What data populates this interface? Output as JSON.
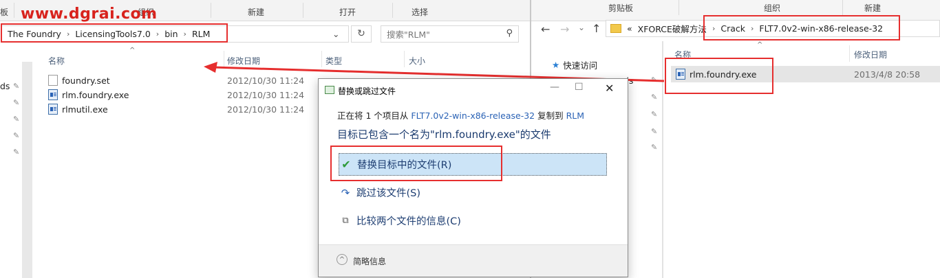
{
  "watermark": "www.dgrai.com",
  "left_window": {
    "ribbon": {
      "group_partial": "板",
      "group_organize": "组织",
      "group_new": "新建",
      "group_open": "打开",
      "group_select": "选择"
    },
    "breadcrumb": [
      "The Foundry",
      "LicensingTools7.0",
      "bin",
      "RLM"
    ],
    "search_placeholder": "搜索\"RLM\"",
    "columns": {
      "name": "名称",
      "date": "修改日期",
      "type": "类型",
      "size": "大小"
    },
    "files": [
      {
        "name": "foundry.set",
        "date": "2012/10/30 11:24",
        "icon": "document-icon"
      },
      {
        "name": "rlm.foundry.exe",
        "date": "2012/10/30 11:24",
        "icon": "exe-icon"
      },
      {
        "name": "rlmutil.exe",
        "date": "2012/10/30 11:24",
        "icon": "exe-icon"
      }
    ],
    "nav_partial": "ds"
  },
  "right_window": {
    "ribbon": {
      "group_clipboard": "剪贴板",
      "group_organize": "组织",
      "group_new": "新建"
    },
    "breadcrumb_prefix": "«",
    "breadcrumb": [
      "XFORCE破解方法",
      "Crack",
      "FLT7.0v2-win-x86-release-32"
    ],
    "quick_access": "快速访问",
    "nav_partial": "ds",
    "columns": {
      "name": "名称",
      "date": "修改日期"
    },
    "files": [
      {
        "name": "rlm.foundry.exe",
        "date": "2013/4/8 20:58",
        "icon": "exe-icon"
      }
    ]
  },
  "dialog": {
    "title": "替换或跳过文件",
    "copy_line": {
      "prefix": "正在将 1 个项目从 ",
      "source": "FLT7.0v2-win-x86-release-32",
      "mid": " 复制到 ",
      "dest": "RLM"
    },
    "heading": "目标已包含一个名为\"rlm.foundry.exe\"的文件",
    "option_replace": "替换目标中的文件(R)",
    "option_skip": "跳过该文件(S)",
    "option_compare": "比较两个文件的信息(C)",
    "footer_label": "简略信息"
  },
  "colors": {
    "annotation_red": "#e62e2e",
    "link_blue": "#2a62b5",
    "selection_blue": "#cce4f7"
  }
}
